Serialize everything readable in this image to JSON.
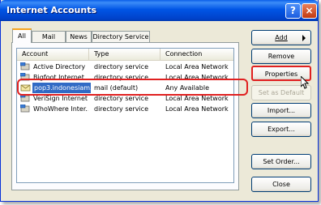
{
  "window": {
    "title": "Internet Accounts",
    "help_label": "?",
    "close_label": "×"
  },
  "tabs": [
    {
      "label": "All"
    },
    {
      "label": "Mail"
    },
    {
      "label": "News"
    },
    {
      "label": "Directory Service"
    }
  ],
  "list": {
    "columns": [
      "Account",
      "Type",
      "Connection"
    ],
    "rows": [
      {
        "account": "Active Directory",
        "type": "directory service",
        "connection": "Local Area Network"
      },
      {
        "account": "Bigfoot Internet ...",
        "type": "directory service",
        "connection": "Local Area Network"
      },
      {
        "account": "pop3.indonesiam...",
        "type": "mail (default)",
        "connection": "Any Available"
      },
      {
        "account": "VeriSign Internet ...",
        "type": "directory service",
        "connection": "Local Area Network"
      },
      {
        "account": "WhoWhere Inter...",
        "type": "directory service",
        "connection": "Local Area Network"
      }
    ]
  },
  "buttons": {
    "add": "Add",
    "remove": "Remove",
    "properties": "Properties",
    "set_default": "Set as Default",
    "import": "Import...",
    "export": "Export...",
    "set_order": "Set Order...",
    "close": "Close"
  },
  "colors": {
    "title_bar": "#0055e5",
    "selection": "#316ac5",
    "highlight_annotation": "#e02020"
  }
}
